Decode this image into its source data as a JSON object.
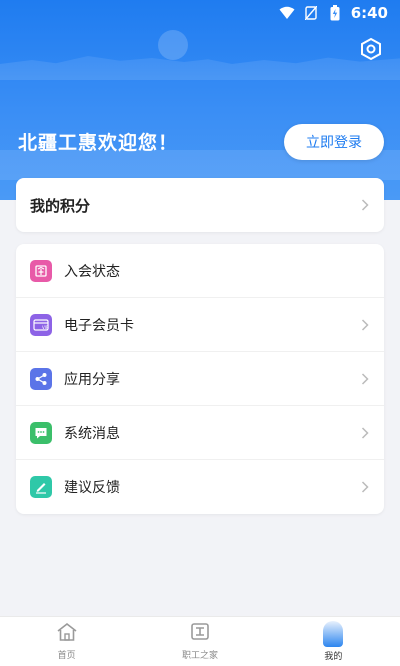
{
  "status_bar": {
    "time": "6:40",
    "icons": [
      "wifi-icon",
      "no-sim-icon",
      "battery-charging-icon"
    ]
  },
  "header": {
    "welcome": "北疆工惠欢迎您！",
    "login_button": "立即登录",
    "settings_icon": "settings-hexagon-icon"
  },
  "points_card": {
    "label": "我的积分"
  },
  "menu": {
    "items": [
      {
        "label": "入会状态",
        "icon": "membership-status-icon",
        "color": "#e85aa8",
        "show_chevron": false
      },
      {
        "label": "电子会员卡",
        "icon": "vip-card-icon",
        "color": "#8d63e6",
        "show_chevron": true
      },
      {
        "label": "应用分享",
        "icon": "share-icon",
        "color": "#5b74e8",
        "show_chevron": true
      },
      {
        "label": "系统消息",
        "icon": "message-icon",
        "color": "#3bbf6a",
        "show_chevron": true
      },
      {
        "label": "建议反馈",
        "icon": "feedback-icon",
        "color": "#2fc8a8",
        "show_chevron": true
      }
    ]
  },
  "tabbar": {
    "tabs": [
      {
        "label": "首页",
        "icon": "home-icon",
        "active": false
      },
      {
        "label": "职工之家",
        "icon": "workers-home-icon",
        "active": false
      },
      {
        "label": "我的",
        "icon": "mine-icon",
        "active": true
      }
    ]
  },
  "colors": {
    "primary": "#1f7cf0",
    "background": "#f2f3f7"
  }
}
